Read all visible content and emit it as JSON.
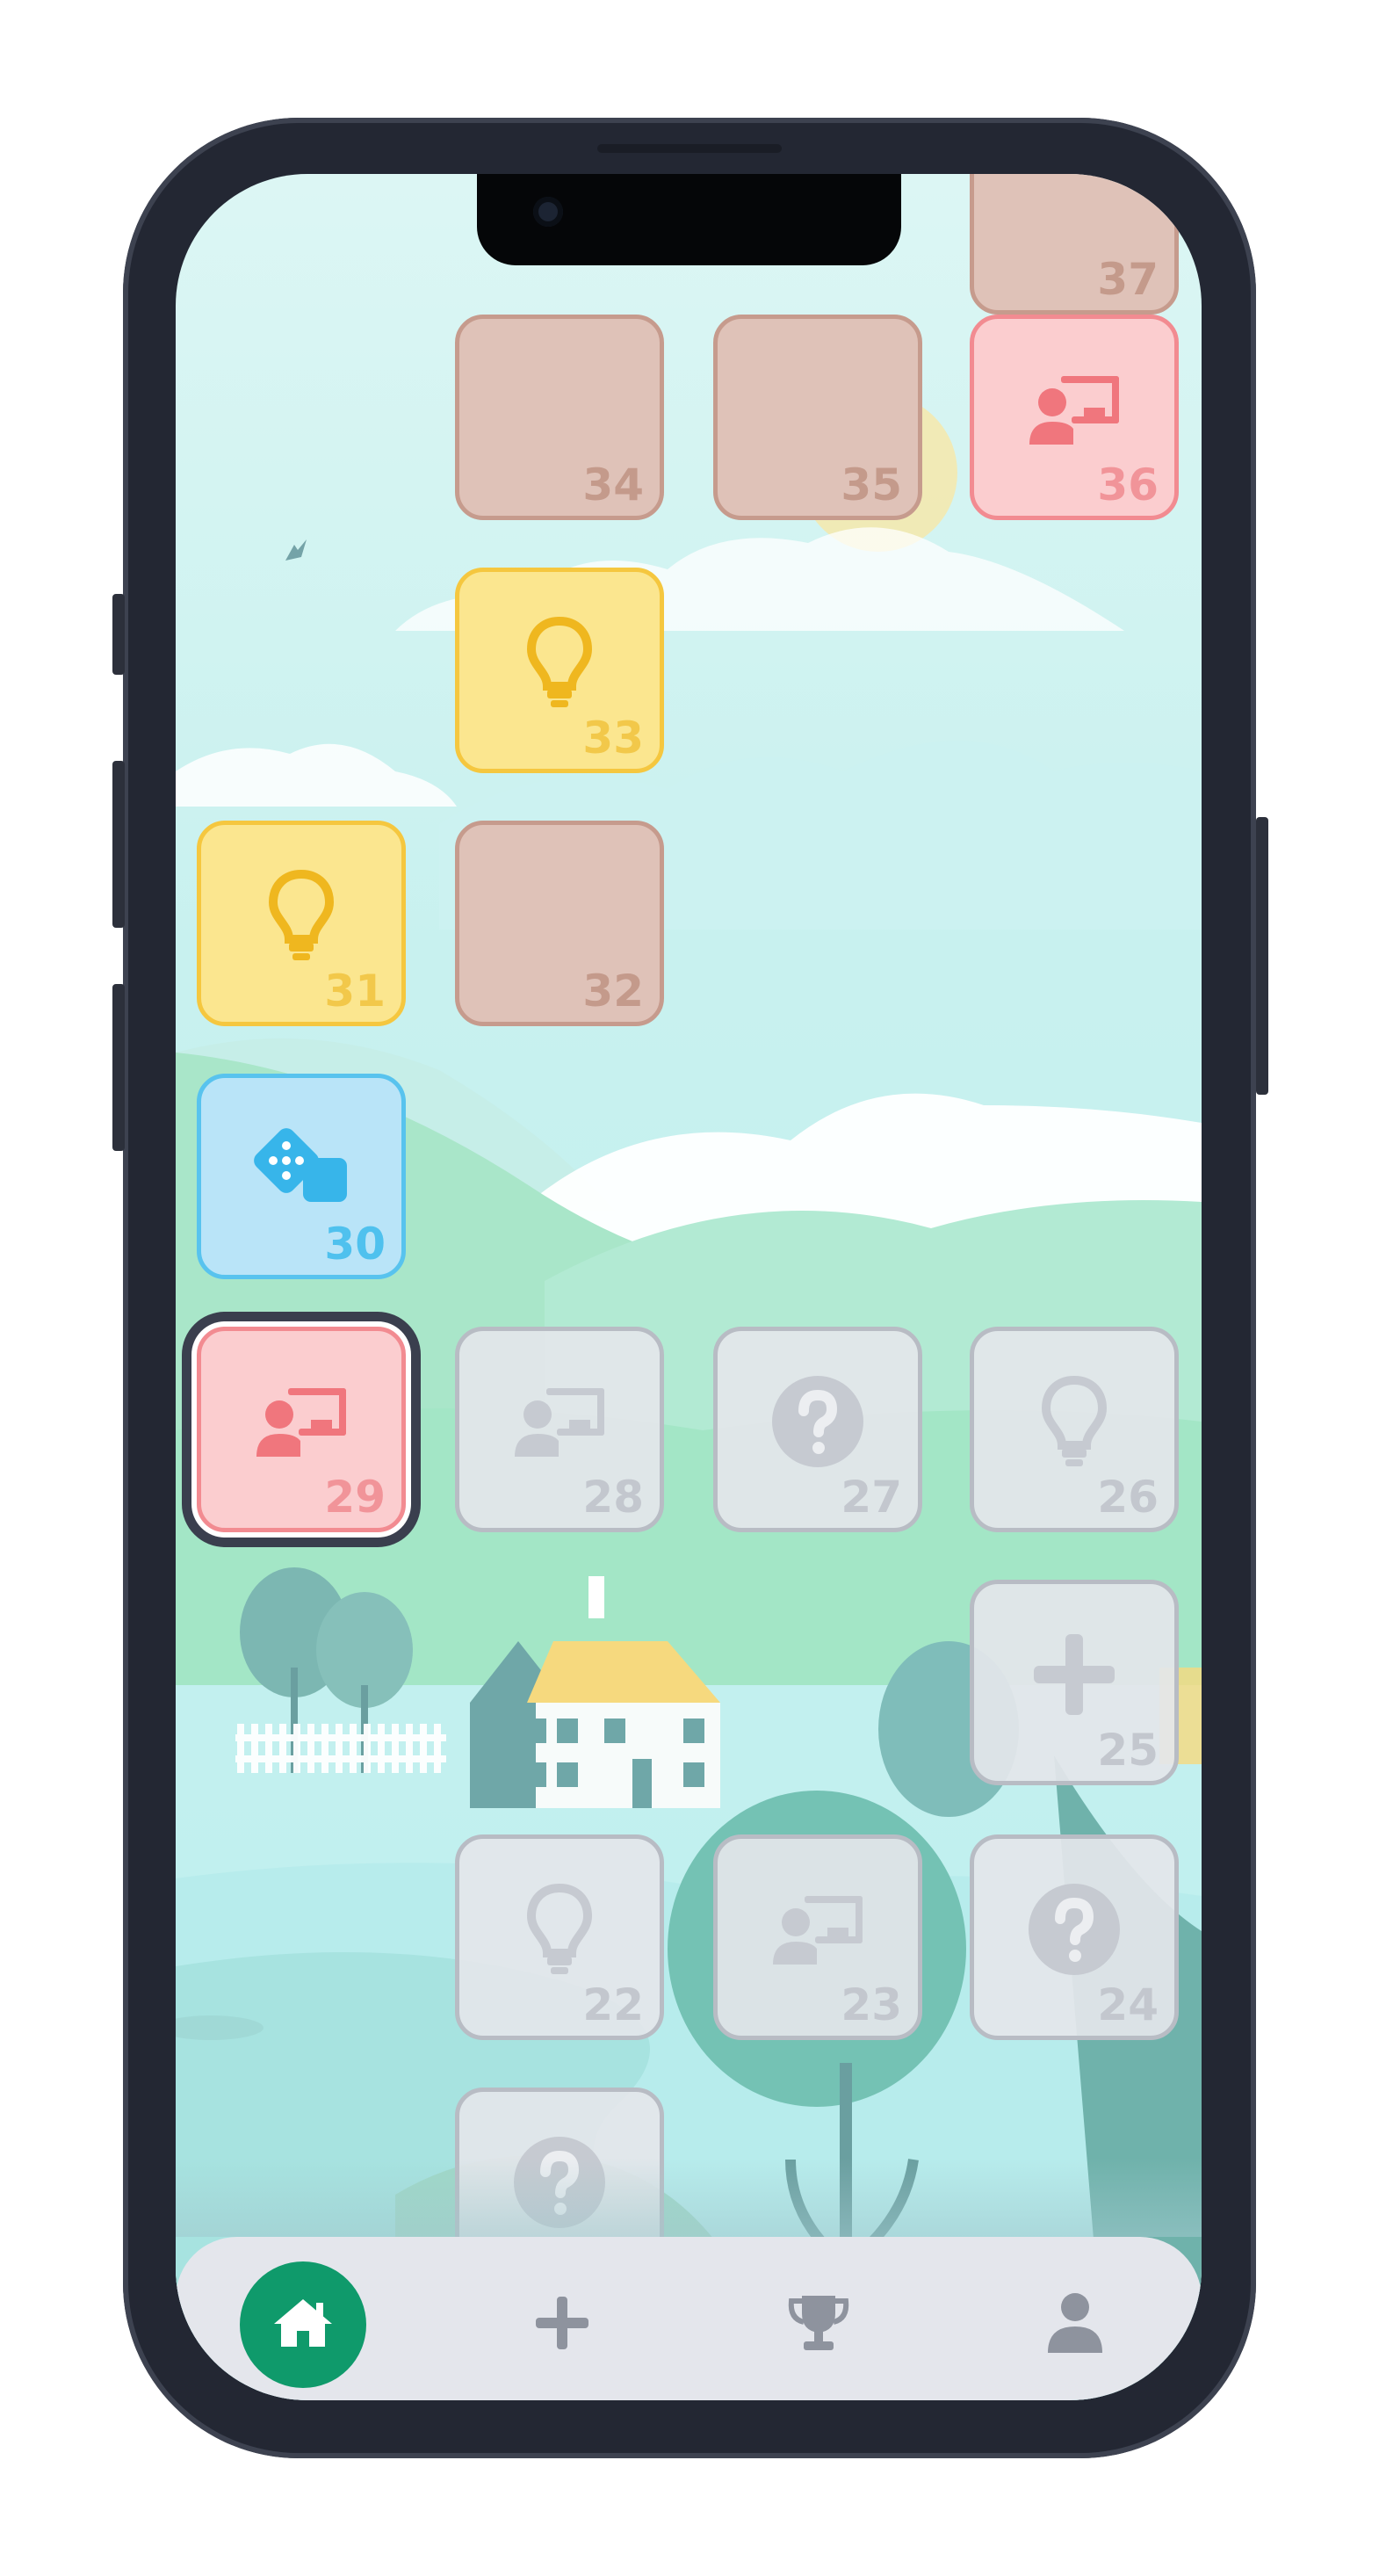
{
  "levels": [
    {
      "number": "37",
      "type": "brown",
      "icon": ""
    },
    {
      "number": "34",
      "type": "brown",
      "icon": ""
    },
    {
      "number": "35",
      "type": "brown",
      "icon": ""
    },
    {
      "number": "36",
      "type": "red",
      "icon": "presentation-icon"
    },
    {
      "number": "33",
      "type": "yellow",
      "icon": "lightbulb-icon"
    },
    {
      "number": "31",
      "type": "yellow",
      "icon": "lightbulb-icon"
    },
    {
      "number": "32",
      "type": "brown",
      "icon": ""
    },
    {
      "number": "30",
      "type": "blue",
      "icon": "dice-icon"
    },
    {
      "number": "29",
      "type": "red",
      "icon": "presentation-icon",
      "current": true
    },
    {
      "number": "28",
      "type": "grey",
      "icon": "presentation-icon"
    },
    {
      "number": "27",
      "type": "grey",
      "icon": "question-icon"
    },
    {
      "number": "26",
      "type": "grey",
      "icon": "lightbulb-icon"
    },
    {
      "number": "25",
      "type": "grey",
      "icon": "plus-icon"
    },
    {
      "number": "22",
      "type": "grey",
      "icon": "lightbulb-icon"
    },
    {
      "number": "23",
      "type": "grey",
      "icon": "presentation-icon"
    },
    {
      "number": "24",
      "type": "grey",
      "icon": "question-icon"
    },
    {
      "number": "",
      "type": "grey",
      "icon": "question-icon"
    }
  ],
  "nav": {
    "items": [
      {
        "name": "home",
        "icon": "home-icon",
        "active": true
      },
      {
        "name": "add",
        "icon": "plus-icon",
        "active": false
      },
      {
        "name": "trophy",
        "icon": "trophy-icon",
        "active": false
      },
      {
        "name": "profile",
        "icon": "user-icon",
        "active": false
      }
    ]
  },
  "colors": {
    "nav_active": "#0f9a6b",
    "nav_inactive": "#8e939e",
    "brown_tile": "#dfc2b8",
    "red_tile": "#fbcdcf",
    "yellow_tile": "#fbe68f",
    "blue_tile": "#b9e4f8",
    "grey_tile": "#e4e6ea"
  }
}
